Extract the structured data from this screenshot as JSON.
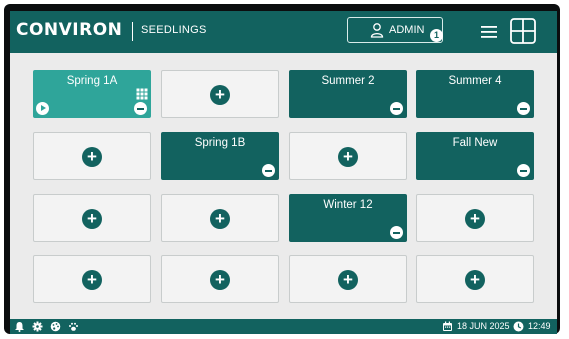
{
  "header": {
    "brand": "CONVIRON",
    "section": "SEEDLINGS",
    "user_label": "ADMIN",
    "notification_count": "1"
  },
  "chambers": [
    {
      "name": "Spring 1A",
      "state": "active"
    },
    {
      "name": "",
      "state": "empty"
    },
    {
      "name": "Summer 2",
      "state": "filled"
    },
    {
      "name": "Summer 4",
      "state": "filled"
    },
    {
      "name": "",
      "state": "empty"
    },
    {
      "name": "Spring 1B",
      "state": "filled"
    },
    {
      "name": "",
      "state": "empty"
    },
    {
      "name": "Fall New",
      "state": "filled"
    },
    {
      "name": "",
      "state": "empty"
    },
    {
      "name": "",
      "state": "empty"
    },
    {
      "name": "Winter 12",
      "state": "filled"
    },
    {
      "name": "",
      "state": "empty"
    },
    {
      "name": "",
      "state": "empty"
    },
    {
      "name": "",
      "state": "empty"
    },
    {
      "name": "",
      "state": "empty"
    },
    {
      "name": "",
      "state": "empty"
    }
  ],
  "add_symbol": "+",
  "footer": {
    "date": "18 JUN 2025",
    "time": "12:49",
    "icons": [
      "bell-icon",
      "gear-icon",
      "palette-icon",
      "paw-icon",
      "calendar-icon",
      "clock-icon"
    ]
  },
  "colors": {
    "primary": "#12625f",
    "active": "#2fa59a",
    "empty_tile": "#f3f3f3",
    "background": "#ebebeb"
  }
}
